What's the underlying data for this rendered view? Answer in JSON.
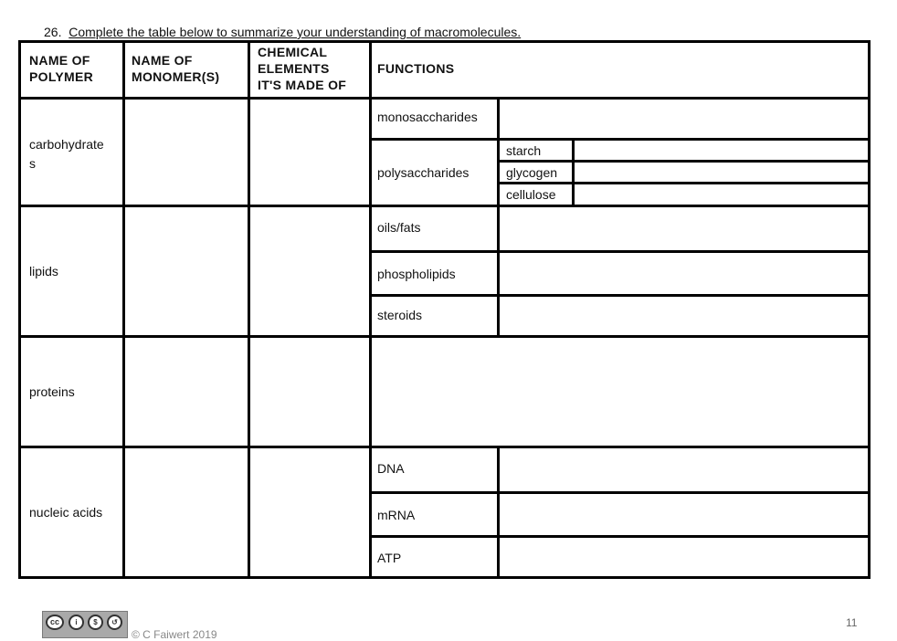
{
  "question": {
    "number": "26.",
    "text": "Complete the table below to summarize your understanding of macromolecules."
  },
  "table": {
    "headers": {
      "polymer": [
        "NAME OF",
        "POLYMER"
      ],
      "monomer": [
        "NAME OF",
        "MONOMER(S)"
      ],
      "elements": [
        "CHEMICAL",
        "ELEMENTS",
        "IT'S MADE OF"
      ],
      "functions": "FUNCTIONS"
    },
    "rows": [
      {
        "polymer": [
          "carbohydrate",
          "s"
        ],
        "monomer": "",
        "elements": "",
        "functions": [
          {
            "label": "monosaccharides",
            "value": ""
          },
          {
            "label": "polysaccharides",
            "subitems": [
              {
                "label": "starch",
                "value": ""
              },
              {
                "label": "glycogen",
                "value": ""
              },
              {
                "label": "cellulose",
                "value": ""
              }
            ]
          }
        ]
      },
      {
        "polymer": [
          "lipids"
        ],
        "monomer": "",
        "elements": "",
        "functions": [
          {
            "label": "oils/fats",
            "value": ""
          },
          {
            "label": "phospholipids",
            "value": ""
          },
          {
            "label": "steroids",
            "value": ""
          }
        ]
      },
      {
        "polymer": [
          "proteins"
        ],
        "monomer": "",
        "elements": "",
        "functions": []
      },
      {
        "polymer": [
          "nucleic acids"
        ],
        "monomer": "",
        "elements": "",
        "functions": [
          {
            "label": "DNA",
            "value": ""
          },
          {
            "label": "mRNA",
            "value": ""
          },
          {
            "label": "ATP",
            "value": ""
          }
        ]
      }
    ]
  },
  "footer": {
    "license_icons": [
      "cc-icon",
      "by-icon",
      "nc-icon",
      "sa-icon"
    ],
    "license_labels": [
      "BY",
      "NC",
      "SA"
    ],
    "copyright": "© C Faiwert 2019",
    "page_number": "11"
  }
}
